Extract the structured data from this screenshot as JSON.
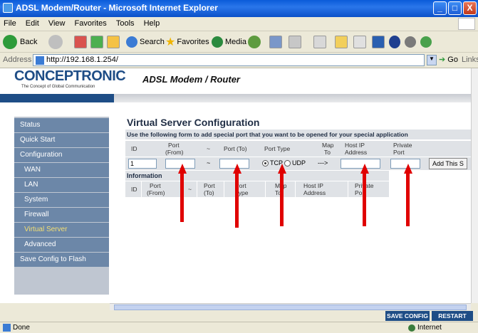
{
  "window": {
    "title": "ADSL Modem/Router - Microsoft Internet Explorer",
    "minimize": "_",
    "maximize": "□",
    "close": "X"
  },
  "menu": [
    "File",
    "Edit",
    "View",
    "Favorites",
    "Tools",
    "Help"
  ],
  "toolbar": {
    "back": "Back",
    "search": "Search",
    "favorites": "Favorites",
    "media": "Media"
  },
  "address": {
    "label": "Address",
    "url": "http://192.168.1.254/",
    "go": "Go",
    "links": "Links"
  },
  "header": {
    "brand": "CONCEPTRONIC",
    "tagline": "The Concept of Global Communication",
    "router_title": "ADSL Modem / Router"
  },
  "sidebar": {
    "items": [
      {
        "label": "Status"
      },
      {
        "label": "Quick Start"
      },
      {
        "label": "Configuration"
      },
      {
        "label": "WAN"
      },
      {
        "label": "LAN"
      },
      {
        "label": "System"
      },
      {
        "label": "Firewall"
      },
      {
        "label": "Virtual Server"
      },
      {
        "label": "Advanced"
      },
      {
        "label": "Save Config to Flash"
      }
    ]
  },
  "vs": {
    "title": "Virtual Server Configuration",
    "description": "Use the following form to add special port that you want to be opened for your special application",
    "headers": {
      "id": "ID",
      "port_from_1": "Port",
      "port_from_2": "(From)",
      "tilde": "~",
      "port_to": "Port (To)",
      "port_type": "Port Type",
      "map_to_1": "Map",
      "map_to_2": "To",
      "host_ip_1": "Host IP",
      "host_ip_2": "Address",
      "private_port_1": "Private",
      "private_port_2": "Port"
    },
    "form": {
      "id_value": "1",
      "tilde": "~",
      "tcp": "TCP",
      "udp": "UDP",
      "arrow": "--->",
      "add_button": "Add This S"
    },
    "info": {
      "title": "Information",
      "id": "ID",
      "port_from_1": "Port",
      "port_from_2": "(From)",
      "tilde": "~",
      "port_to_1": "Port",
      "port_to_2": "(To)",
      "port_type_1": "Port",
      "port_type_2": "Type",
      "map_to_1": "Map",
      "map_to_2": "To",
      "host_ip_1": "Host IP",
      "host_ip_2": "Address",
      "private_port_1": "Private",
      "private_port_2": "Port"
    }
  },
  "actions": {
    "save_config": "SAVE CONFIG",
    "restart": "RESTART"
  },
  "status": {
    "done": "Done",
    "zone": "Internet"
  }
}
